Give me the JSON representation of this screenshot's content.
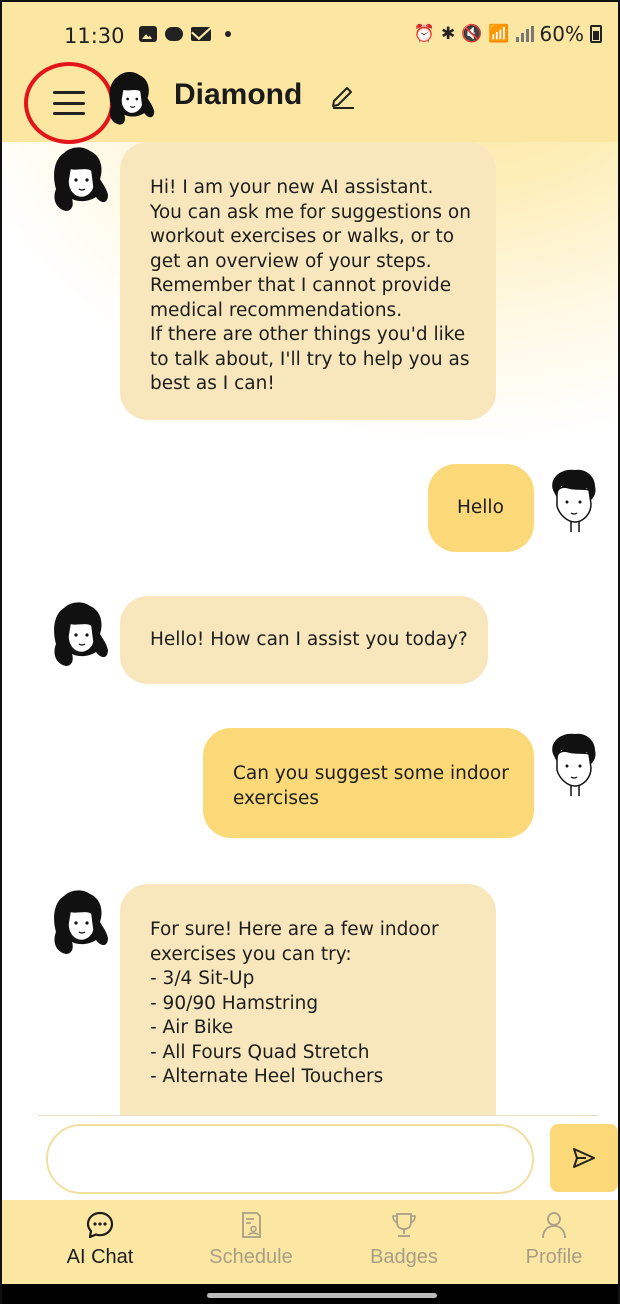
{
  "status_bar": {
    "time": "11:30",
    "battery": "60%"
  },
  "header": {
    "title": "Diamond"
  },
  "messages": [
    {
      "sender": "assistant",
      "text": "Hi! I am your new AI assistant.\nYou can ask me for suggestions on\nworkout exercises or walks, or to\nget an overview of your steps.\nRemember that I cannot provide\nmedical recommendations.\nIf there are other things you'd like\nto talk about, I'll try to help you as\nbest as I can!"
    },
    {
      "sender": "user",
      "text": "Hello"
    },
    {
      "sender": "assistant",
      "text": "Hello! How can I assist you today?"
    },
    {
      "sender": "user",
      "text": "Can you suggest some indoor\nexercises"
    },
    {
      "sender": "assistant",
      "text": "For sure! Here are a few indoor\nexercises you can try:\n- 3/4 Sit-Up\n- 90/90 Hamstring\n- Air Bike\n- All Fours Quad Stretch\n- Alternate Heel Touchers"
    }
  ],
  "input": {
    "value": "",
    "placeholder": ""
  },
  "nav": {
    "items": [
      {
        "label": "AI Chat",
        "icon": "chat-bubble-icon",
        "active": true
      },
      {
        "label": "Schedule",
        "icon": "schedule-icon",
        "active": false
      },
      {
        "label": "Badges",
        "icon": "trophy-icon",
        "active": false
      },
      {
        "label": "Profile",
        "icon": "person-icon",
        "active": false
      }
    ]
  },
  "colors": {
    "header_bg": "#fbe7a2",
    "bot_bubble": "#f8e6bd",
    "user_bubble": "#fcd978",
    "highlight_circle": "#e3151a",
    "nav_inactive": "#a89e88"
  }
}
